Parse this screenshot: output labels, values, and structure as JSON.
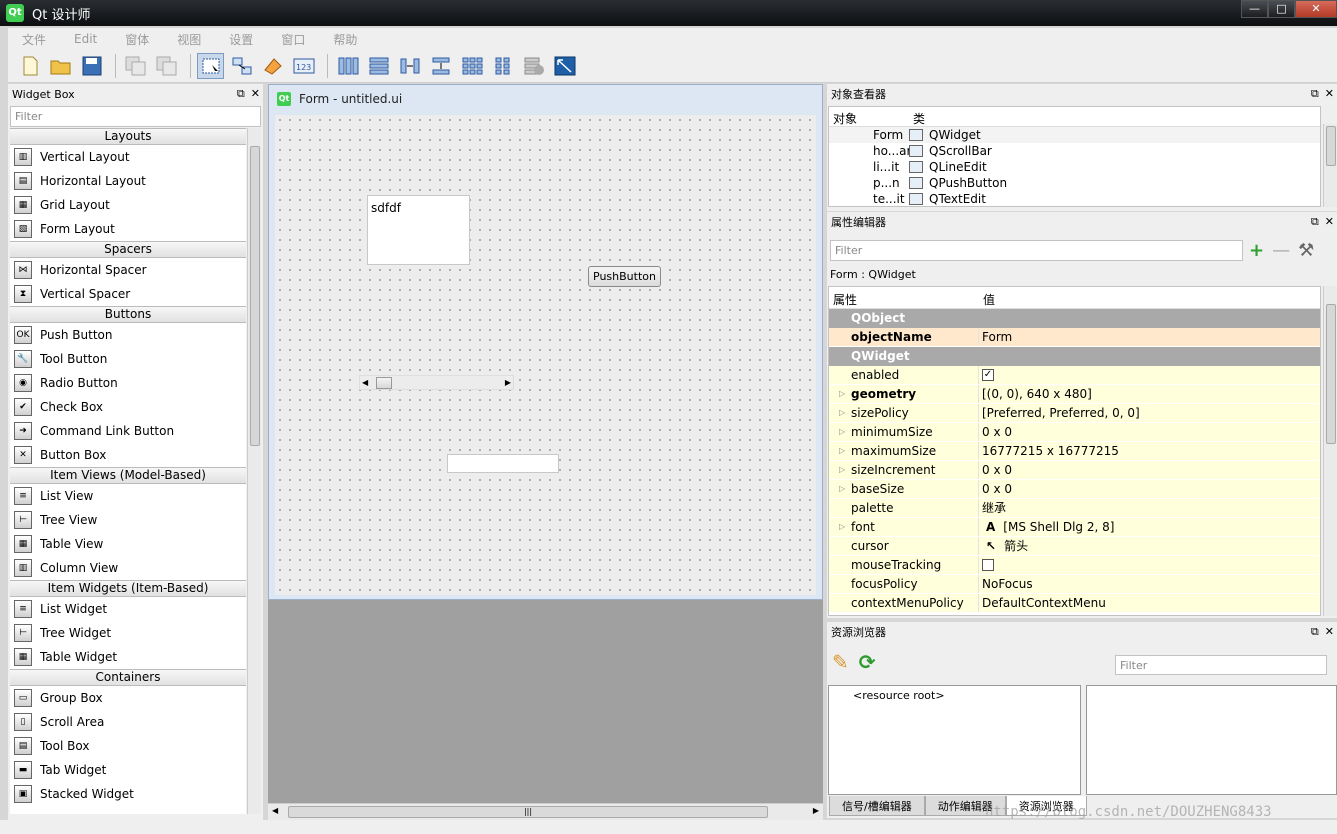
{
  "window": {
    "title": "Qt 设计师",
    "logo_text": "Qt"
  },
  "menubar": [
    "文件",
    "Edit",
    "窗体",
    "视图",
    "设置",
    "窗口",
    "帮助"
  ],
  "widget_box": {
    "title": "Widget Box",
    "filter_placeholder": "Filter",
    "categories": [
      {
        "name": "Layouts",
        "items": [
          "Vertical Layout",
          "Horizontal Layout",
          "Grid Layout",
          "Form Layout"
        ]
      },
      {
        "name": "Spacers",
        "items": [
          "Horizontal Spacer",
          "Vertical Spacer"
        ]
      },
      {
        "name": "Buttons",
        "items": [
          "Push Button",
          "Tool Button",
          "Radio Button",
          "Check Box",
          "Command Link Button",
          "Button Box"
        ]
      },
      {
        "name": "Item Views (Model-Based)",
        "items": [
          "List View",
          "Tree View",
          "Table View",
          "Column View"
        ]
      },
      {
        "name": "Item Widgets (Item-Based)",
        "items": [
          "List Widget",
          "Tree Widget",
          "Table Widget"
        ]
      },
      {
        "name": "Containers",
        "items": [
          "Group Box",
          "Scroll Area",
          "Tool Box",
          "Tab Widget",
          "Stacked Widget"
        ]
      }
    ]
  },
  "form": {
    "title": "Form - untitled.ui",
    "textedit_text": "sdfdf",
    "pushbutton_text": "PushButton"
  },
  "object_inspector": {
    "title": "对象查看器",
    "col_object": "对象",
    "col_class": "类",
    "rows": [
      {
        "object": "Form",
        "class": "QWidget"
      },
      {
        "object": "ho...ar",
        "class": "QScrollBar"
      },
      {
        "object": "li...it",
        "class": "QLineEdit"
      },
      {
        "object": "p...n",
        "class": "QPushButton"
      },
      {
        "object": "te...it",
        "class": "QTextEdit"
      }
    ]
  },
  "property_editor": {
    "title": "属性编辑器",
    "filter_placeholder": "Filter",
    "class_label": "Form : QWidget",
    "col_property": "属性",
    "col_value": "值",
    "group_qobject": "QObject",
    "group_qwidget": "QWidget",
    "object_name": {
      "key": "objectName",
      "value": "Form"
    },
    "rows": [
      {
        "key": "enabled",
        "value": "",
        "checkbox": true,
        "checked": true,
        "bold": false,
        "expandable": false
      },
      {
        "key": "geometry",
        "value": "[(0, 0), 640 x 480]",
        "bold": true,
        "expandable": true
      },
      {
        "key": "sizePolicy",
        "value": "[Preferred, Preferred, 0, 0]",
        "bold": false,
        "expandable": true
      },
      {
        "key": "minimumSize",
        "value": "0 x 0",
        "bold": false,
        "expandable": true
      },
      {
        "key": "maximumSize",
        "value": "16777215 x 16777215",
        "bold": false,
        "expandable": true
      },
      {
        "key": "sizeIncrement",
        "value": "0 x 0",
        "bold": false,
        "expandable": true
      },
      {
        "key": "baseSize",
        "value": "0 x 0",
        "bold": false,
        "expandable": true
      },
      {
        "key": "palette",
        "value": "继承",
        "bold": false,
        "expandable": false
      },
      {
        "key": "font",
        "value": "[MS Shell Dlg 2, 8]",
        "prefix": "A",
        "bold": false,
        "expandable": true
      },
      {
        "key": "cursor",
        "value": "箭头",
        "prefix": "↖",
        "bold": false,
        "expandable": false
      },
      {
        "key": "mouseTracking",
        "value": "",
        "checkbox": true,
        "checked": false,
        "bold": false,
        "expandable": false
      },
      {
        "key": "focusPolicy",
        "value": "NoFocus",
        "bold": false,
        "expandable": false
      },
      {
        "key": "contextMenuPolicy",
        "value": "DefaultContextMenu",
        "bold": false,
        "expandable": false
      }
    ]
  },
  "resource_browser": {
    "title": "资源浏览器",
    "filter_placeholder": "Filter",
    "root_label": "<resource root>"
  },
  "bottom_tabs": [
    "信号/槽编辑器",
    "动作编辑器",
    "资源浏览器"
  ],
  "watermark": "https://blog.csdn.net/DOUZHENG8433"
}
